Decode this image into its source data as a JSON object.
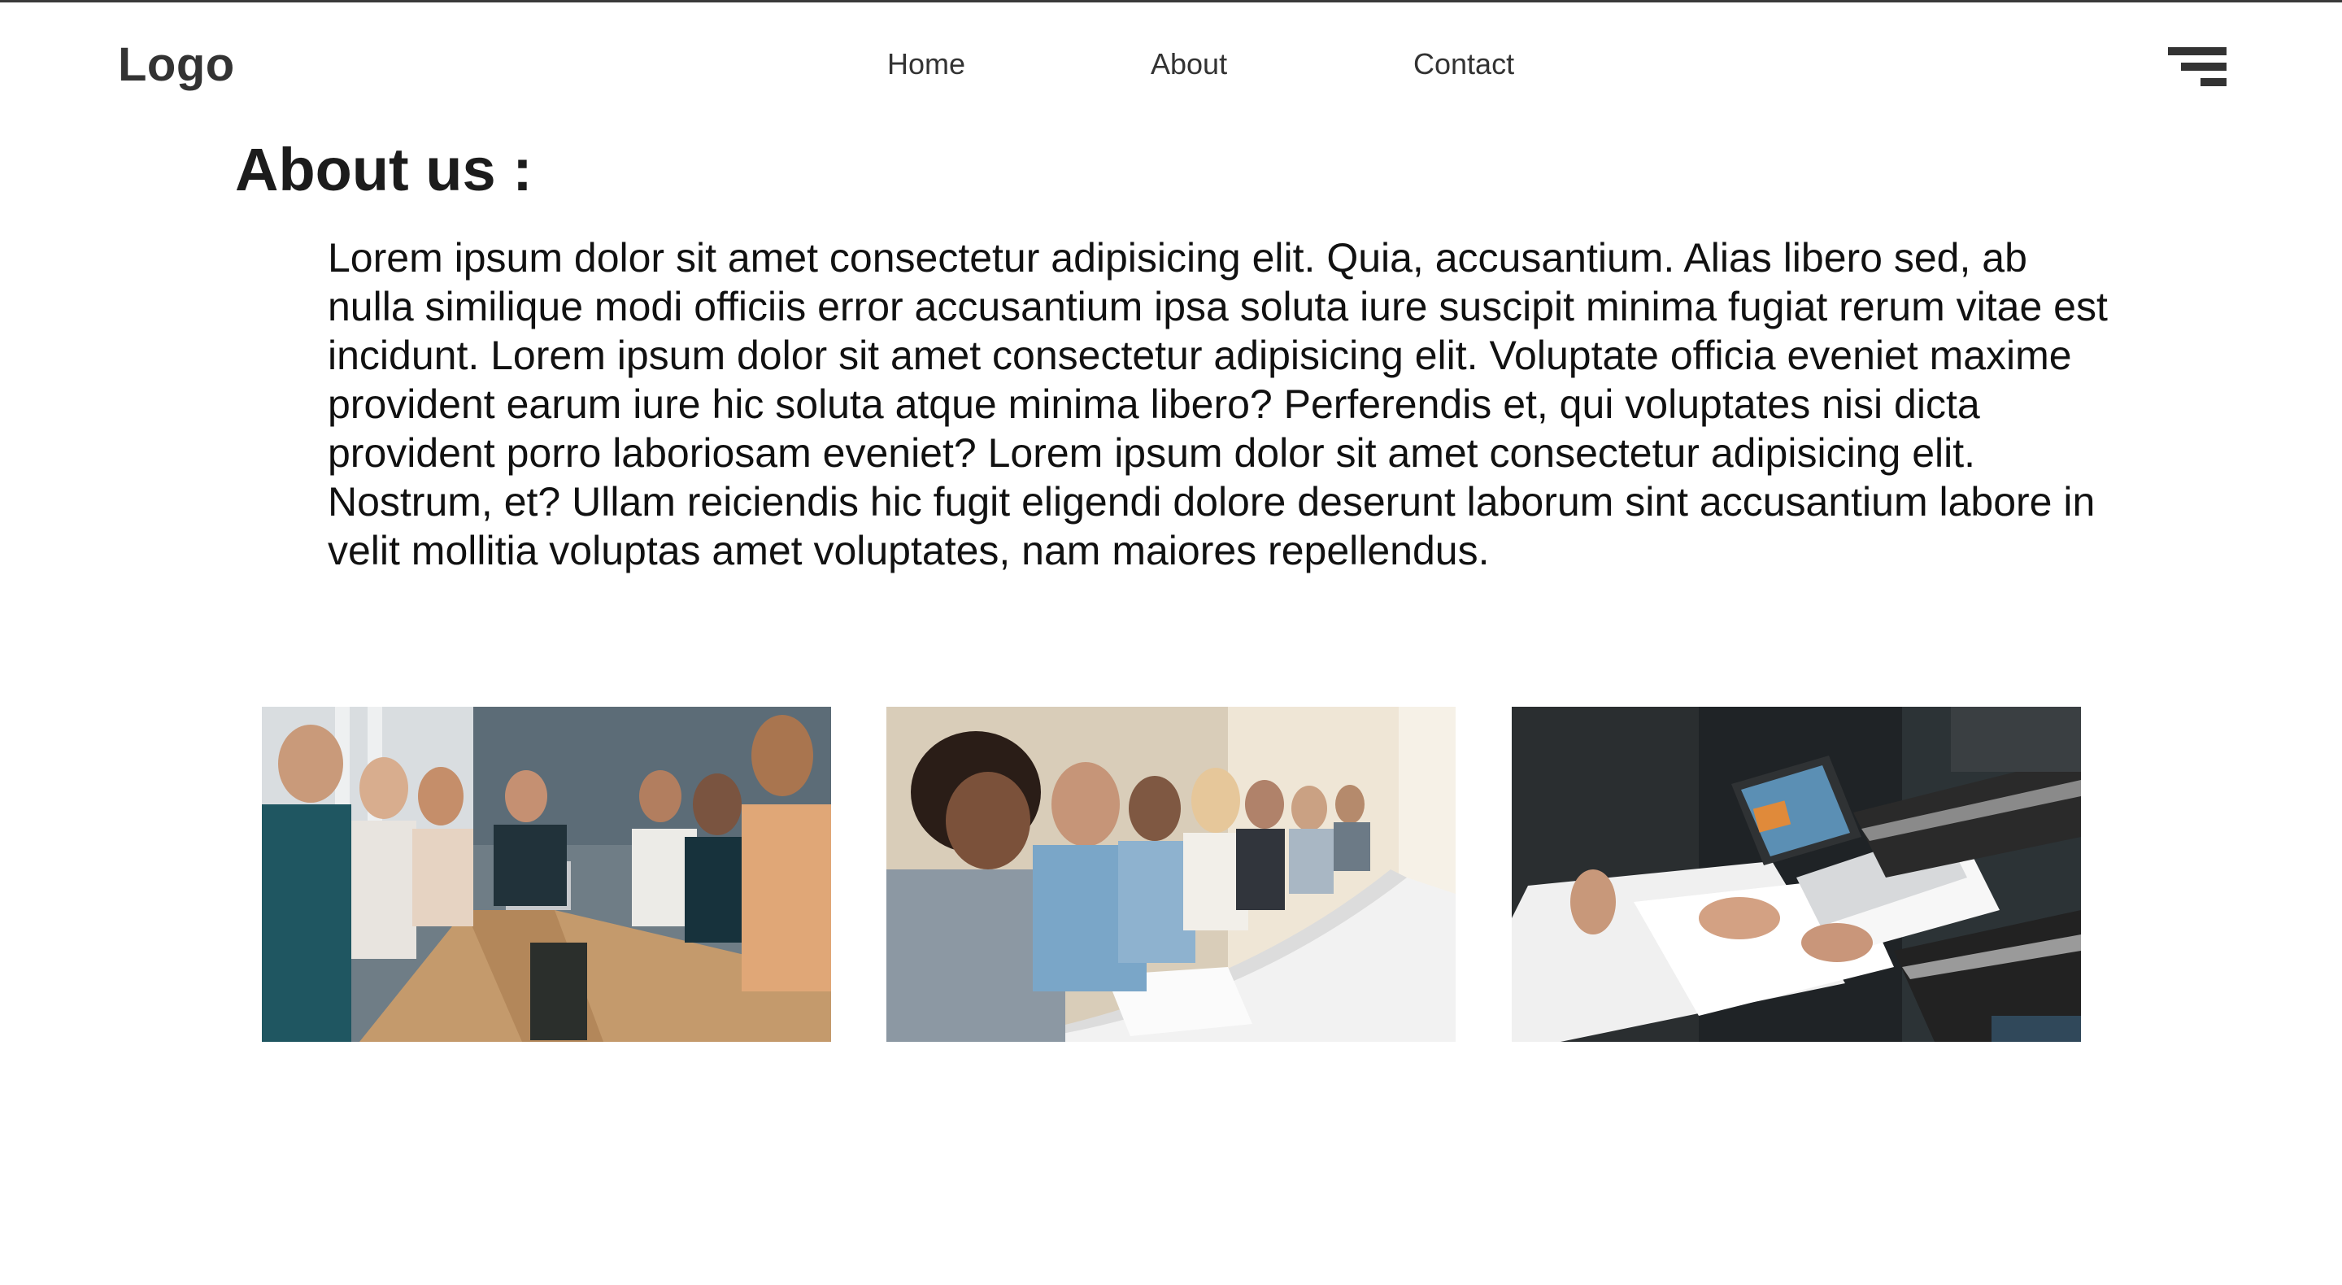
{
  "header": {
    "logo": "Logo",
    "nav": [
      {
        "label": "Home"
      },
      {
        "label": "About"
      },
      {
        "label": "Contact"
      }
    ],
    "menu_icon": "hamburger-menu-icon"
  },
  "main": {
    "title": "About us :",
    "paragraph": "Lorem ipsum dolor sit amet consectetur adipisicing elit. Quia, accusantium. Alias libero sed, ab nulla similique modi officiis error accusantium ipsa soluta iure suscipit minima fugiat rerum vitae est incidunt. Lorem ipsum dolor sit amet consectetur adipisicing elit. Voluptate officia eveniet maxime provident earum iure hic soluta atque minima libero? Perferendis et, qui voluptates nisi dicta provident porro laboriosam eveniet? Lorem ipsum dolor sit amet consectetur adipisicing elit. Nostrum, et? Ullam reiciendis hic fugit eligendi dolore deserunt laborum sint accusantium labore in velit mollitia voluptas amet voluptates, nam maiores repellendus."
  },
  "colors": {
    "text": "#1f1f1f",
    "nav_text": "#333333",
    "background": "#ffffff"
  }
}
